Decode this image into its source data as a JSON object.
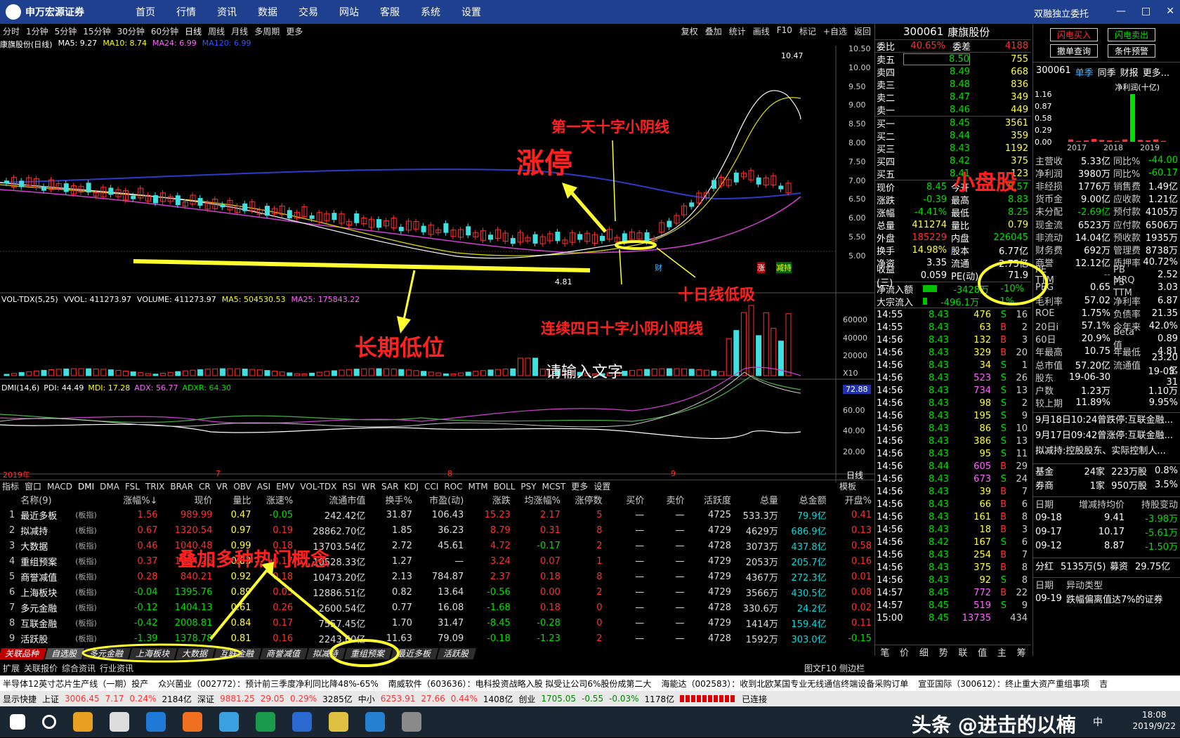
{
  "app": {
    "logo": "申万宏源证券",
    "menus": [
      "首页",
      "行情",
      "资讯",
      "数据",
      "交易",
      "网站",
      "客服",
      "系统",
      "设置"
    ],
    "welcome": "双融独立委托"
  },
  "periods": [
    "分时",
    "1分钟",
    "5分钟",
    "15分钟",
    "30分钟",
    "60分钟",
    "日线",
    "周线",
    "月线",
    "多周期",
    "更多"
  ],
  "tools": [
    "复权",
    "叠加",
    "统计",
    "画线",
    "F10",
    "标记",
    "+自选",
    "返回"
  ],
  "chart_hdr": {
    "name": "康旗股份(日线)",
    "ma5": "MA5: 9.27",
    "ma10": "MA10: 8.74",
    "ma24": "MA24: 6.99",
    "ma120": "MA120: 6.99"
  },
  "price_axis": [
    "10.50",
    "10.00",
    "9.50",
    "9.00",
    "8.50",
    "8.00",
    "7.50",
    "7.00",
    "6.50",
    "6.00",
    "5.50",
    "5.00"
  ],
  "high_label": "10.47",
  "low_label": "4.81",
  "vol_hdr": {
    "name": "VOL-TDX(5,25)",
    "vvol": "VVOL: 411273.97",
    "volume": "VOLUME: 411273.97",
    "ma5": "MA5: 504530.53",
    "ma25": "MA25: 175843.22"
  },
  "vol_axis": [
    "60000",
    "40000",
    "20000",
    "X10"
  ],
  "dmi_hdr": {
    "name": "DMI(14,6)",
    "pdi": "PDI: 44.49",
    "mdi": "MDI: 17.28",
    "adx": "ADX: 56.77",
    "adxr": "ADXR: 64.30"
  },
  "dmi_axis": [
    "72.88",
    "60.00",
    "40.00",
    "20.00"
  ],
  "date_axis": [
    "2019年",
    "7",
    "8",
    "9"
  ],
  "day_line": "日线",
  "indicators": [
    "指标",
    "窗口",
    "MACD",
    "DMI",
    "DMA",
    "FSL",
    "TRIX",
    "BRAR",
    "CR",
    "VR",
    "OBV",
    "ASI",
    "EMV",
    "VOL-TDX",
    "RSI",
    "WR",
    "SAR",
    "KDJ",
    "CCI",
    "ROC",
    "MTM",
    "BOLL",
    "PSY",
    "MCST",
    "更多",
    "设置"
  ],
  "indicator_right": "模板",
  "grid": {
    "headers": [
      "",
      "名称(9)",
      "",
      "涨幅%↓",
      "现价",
      "量比",
      "涨速%",
      "流通市值",
      "换手%",
      "市盈(动)",
      "涨跌",
      "均涨幅%",
      "涨停数",
      "买价",
      "卖价",
      "活跃度",
      "总量",
      "总金额",
      "开盘%"
    ],
    "rows": [
      [
        "1",
        "最近多板",
        "(板指)",
        "1.56",
        "989.99",
        "0.47",
        "-0.05",
        "242.42亿",
        "31.87",
        "106.43",
        "15.23",
        "2.17",
        "5",
        "—",
        "—",
        "4725",
        "533.3万",
        "79.9亿",
        "0.41"
      ],
      [
        "2",
        "拟减持",
        "(板指)",
        "0.67",
        "1320.54",
        "0.97",
        "0.19",
        "28862.70亿",
        "1.85",
        "36.23",
        "8.79",
        "0.31",
        "8",
        "—",
        "—",
        "4729",
        "4629万",
        "686.9亿",
        "0.13"
      ],
      [
        "3",
        "大数据",
        "(板指)",
        "0.46",
        "1040.48",
        "0.99",
        "0.18",
        "13703.54亿",
        "2.72",
        "45.61",
        "4.72",
        "-0.17",
        "2",
        "—",
        "—",
        "4728",
        "3073万",
        "437.8亿",
        "0.58"
      ],
      [
        "4",
        "重组预案",
        "(板指)",
        "0.37",
        "1004.26",
        "0.83",
        "0.17",
        "10528.33亿",
        "1.27",
        "—",
        "3.24",
        "0.07",
        "1",
        "—",
        "—",
        "4729",
        "2053万",
        "205.7亿",
        "0.16"
      ],
      [
        "5",
        "商誉减值",
        "(板指)",
        "0.28",
        "840.21",
        "0.92",
        "0.18",
        "10473.20亿",
        "2.13",
        "784.87",
        "2.37",
        "0.18",
        "8",
        "—",
        "—",
        "4729",
        "4367万",
        "272.3亿",
        "0.01"
      ],
      [
        "6",
        "上海板块",
        "(板指)",
        "-0.04",
        "1395.76",
        "0.89",
        "0.05",
        "12886.51亿",
        "0.82",
        "13.64",
        "-0.56",
        "0.00",
        "2",
        "—",
        "—",
        "4729",
        "3566万",
        "430.5亿",
        "0.08"
      ],
      [
        "7",
        "多元金融",
        "(板指)",
        "-0.12",
        "1404.13",
        "0.61",
        "0.26",
        "2600.54亿",
        "0.77",
        "16.08",
        "-1.68",
        "0.18",
        "0",
        "—",
        "—",
        "4728",
        "330.6万",
        "24.2亿",
        "0.02"
      ],
      [
        "8",
        "互联金融",
        "(板指)",
        "-0.42",
        "2008.81",
        "0.84",
        "0.17",
        "7557.45亿",
        "1.70",
        "31.47",
        "-8.45",
        "-0.28",
        "0",
        "—",
        "—",
        "4729",
        "1414万",
        "159.4亿",
        "0.11"
      ],
      [
        "9",
        "活跃股",
        "(板指)",
        "-1.39",
        "1378.78",
        "0.81",
        "0.16",
        "2243.60亿",
        "11.63",
        "79.09",
        "-0.18",
        "-1.23",
        "2",
        "—",
        "—",
        "4728",
        "1592万",
        "303.0亿",
        "-0.15"
      ]
    ]
  },
  "tabs": [
    "关联品种",
    "自选股",
    "多元金融",
    "上海板块",
    "大数据",
    "互联金融",
    "商誉减值",
    "拟减持",
    "重组预案",
    "最近多板",
    "活跃股"
  ],
  "subtabs": [
    "扩展",
    "关联报价",
    "综合资讯",
    "行业资讯"
  ],
  "subtabs_right": "图文F10 侧边栏",
  "quote": {
    "code": "300061",
    "name": "康旗股份",
    "webi": "40.65%",
    "weicha": "4188",
    "asks": [
      [
        "卖五",
        "8.50",
        "755"
      ],
      [
        "卖四",
        "8.49",
        "668"
      ],
      [
        "卖三",
        "8.48",
        "836"
      ],
      [
        "卖二",
        "8.47",
        "349"
      ],
      [
        "卖一",
        "8.46",
        "449"
      ]
    ],
    "bids": [
      [
        "买一",
        "8.45",
        "3561"
      ],
      [
        "买二",
        "8.44",
        "359"
      ],
      [
        "买三",
        "8.43",
        "1192"
      ],
      [
        "买四",
        "8.42",
        "375"
      ],
      [
        "买五",
        "8.41",
        "123"
      ]
    ],
    "stats": [
      [
        "现价",
        "8.45",
        "今开",
        "8.57"
      ],
      [
        "涨跌",
        "-0.39",
        "最高",
        "8.83"
      ],
      [
        "涨幅",
        "-4.41%",
        "最低",
        "8.25"
      ],
      [
        "总量",
        "411274",
        "量比",
        "0.79"
      ],
      [
        "外盘",
        "185229",
        "内盘",
        "226045"
      ],
      [
        "换手",
        "14.98%",
        "股本",
        "6.77亿"
      ],
      [
        "净资",
        "3.35",
        "流通",
        "2.75亿"
      ],
      [
        "收益(三)",
        "0.059",
        "PE(动)",
        "71.9"
      ]
    ],
    "flow": [
      [
        "净流入额",
        "-3428万",
        "-10%"
      ],
      [
        "大宗流入",
        "-496.1万",
        "-1%"
      ]
    ],
    "ticks": [
      [
        "14:55",
        "8.43",
        "476",
        "S",
        "16"
      ],
      [
        "14:55",
        "8.43",
        "63",
        "B",
        "2"
      ],
      [
        "14:56",
        "8.43",
        "132",
        "B",
        "3"
      ],
      [
        "14:56",
        "8.43",
        "329",
        "B",
        "20"
      ],
      [
        "14:56",
        "8.43",
        "34",
        "S",
        "1"
      ],
      [
        "14:56",
        "8.43",
        "523",
        "S",
        "26"
      ],
      [
        "14:56",
        "8.43",
        "734",
        "S",
        "13"
      ],
      [
        "14:56",
        "8.43",
        "98",
        "S",
        "2"
      ],
      [
        "14:56",
        "8.43",
        "195",
        "S",
        "9"
      ],
      [
        "14:56",
        "8.43",
        "86",
        "S",
        "10"
      ],
      [
        "14:56",
        "8.43",
        "386",
        "S",
        "13"
      ],
      [
        "14:56",
        "8.43",
        "95",
        "S",
        "11"
      ],
      [
        "14:56",
        "8.44",
        "605",
        "B",
        "29"
      ],
      [
        "14:56",
        "8.43",
        "673",
        "S",
        "24"
      ],
      [
        "14:56",
        "8.43",
        "39",
        "B",
        "7"
      ],
      [
        "14:56",
        "8.43",
        "66",
        "B",
        "6"
      ],
      [
        "14:56",
        "8.43",
        "161",
        "B",
        "8"
      ],
      [
        "14:56",
        "8.43",
        "18",
        "B",
        "3"
      ],
      [
        "14:56",
        "8.42",
        "167",
        "S",
        "6"
      ],
      [
        "14:56",
        "8.43",
        "254",
        "B",
        "7"
      ],
      [
        "14:56",
        "8.43",
        "375",
        "B",
        "8"
      ],
      [
        "14:56",
        "8.43",
        "92",
        "S",
        "8"
      ],
      [
        "14:57",
        "8.45",
        "772",
        "B",
        "22"
      ],
      [
        "14:57",
        "8.45",
        "519",
        "S",
        "9"
      ],
      [
        "15:00",
        "8.45",
        "13735",
        "",
        "434"
      ]
    ],
    "bottom_tabs": [
      "笔",
      "价",
      "细",
      "势",
      "联",
      "值",
      "主",
      "筹"
    ]
  },
  "fin": {
    "btns": [
      "闪电买入",
      "闪电卖出",
      "撤单查询",
      "条件预警"
    ],
    "code": "300061",
    "tabs": [
      "单季",
      "同季",
      "财报",
      "更多..."
    ],
    "chart_title": "净利润(十亿)",
    "yvals": [
      "1.16",
      "0.87",
      "0.58",
      "0.29",
      "0.00"
    ],
    "years": [
      "2017",
      "2018",
      "2019"
    ],
    "bars": [
      0.05,
      0.02,
      0.03,
      0.06,
      0.04,
      0.03,
      0.02,
      0.05,
      1.0,
      0.04,
      0.03,
      0.05,
      0.02
    ],
    "rows": [
      [
        "主营收",
        "5.33亿",
        "同比%",
        "-44.00"
      ],
      [
        "净利润",
        "3980万",
        "同比%",
        "-60.17"
      ],
      [
        "非经损",
        "1776万",
        "销售费",
        "1.49亿"
      ],
      [
        "货币金",
        "9.00亿",
        "应收款",
        "1.21亿"
      ],
      [
        "未分配",
        "-2.69亿",
        "预付款",
        "4105万"
      ],
      [
        "现金流",
        "6523万",
        "应付款",
        "6506万"
      ],
      [
        "非流动",
        "14.04亿",
        "预收款",
        "1935万"
      ],
      [
        "财务费",
        "692万",
        "管理费",
        "8738万"
      ],
      [
        "商誉",
        "12.12亿",
        "质押率",
        "40.72%"
      ],
      [
        "PE TTM",
        "--",
        "PB MRQ",
        "2.52"
      ],
      [
        "PEG",
        "0.65",
        "PS TTM",
        "3.03"
      ],
      [
        "毛利率",
        "57.02",
        "净利率",
        "6.87"
      ],
      [
        "ROE",
        "1.75%",
        "负债率",
        "21.35"
      ],
      [
        "20日i",
        "57.1%",
        "今年来",
        "42.0%"
      ],
      [
        "60日",
        "20.9%",
        "Beta值",
        "0.89"
      ],
      [
        "年最高",
        "10.75",
        "年最低",
        "4.81"
      ],
      [
        "总市值",
        "57.20亿",
        "流通值",
        "23.20亿"
      ],
      [
        "股东",
        "19-06-30",
        "",
        "19-03-31"
      ],
      [
        "户数",
        "1.23万",
        "",
        "1.10万"
      ],
      [
        "较上期",
        "11.89%",
        "",
        "9.95%"
      ]
    ],
    "news": [
      "9月18日10:24曾跌停:互联金融...",
      "9月17日09:42曾涨停:互联金融...",
      "拟减持:控股股东、实际控制人..."
    ],
    "inst": [
      [
        "基金",
        "24家",
        "223万股",
        "0.8%"
      ],
      [
        "券商",
        "1家",
        "950万股",
        "3.5%"
      ]
    ],
    "hold_hdr": [
      "日期",
      "增减持均价",
      "持股变动"
    ],
    "hold": [
      [
        "09-18",
        "9.41",
        "-3.98万"
      ],
      [
        "09-17",
        "10.17",
        "-5.61万"
      ],
      [
        "09-12",
        "8.87",
        "-1.50万"
      ]
    ],
    "redline": [
      "分红",
      "5135万(5)",
      "募资",
      "29.75亿"
    ],
    "abn_hdr": [
      "日期",
      "异动类型"
    ],
    "abn": [
      "09-19",
      "跌幅偏离值达7%的证券"
    ]
  },
  "annotations": {
    "zt": "涨停",
    "first": "第一天十字小阴线",
    "xpg": "小盘股",
    "low": "长期低位",
    "shiri": "十日线低吸",
    "four": "连续四日十字小阴小阳线",
    "concept": "叠加多种热门概念",
    "input": "请输入文字"
  },
  "chart_marks": [
    "财",
    "涨",
    "减持"
  ],
  "ticker": [
    "半导体12英寸芯片生产线（一期）投产",
    "众兴菌业（002772）：预计前三季度净利同比降48%-65%",
    "南威软件（603636）：电科投资战略入股 拟受让公司6%股份成第二大",
    "海能达（002583）：收到北欧某国专业无线通信终端设备采购订单",
    "宣亚国际（300612）：终止重大资产重组事项",
    "吉"
  ],
  "status": {
    "label": "显示快捷",
    "sh": "上证",
    "sh_v": "3006.45",
    "sh_c": "7.17",
    "sh_p": "0.24%",
    "sh_a": "2184亿",
    "sz": "深证",
    "sz_v": "9881.25",
    "sz_c": "29.05",
    "sz_p": "0.29%",
    "sz_a": "3285亿",
    "zx": "中小",
    "zx_v": "6253.91",
    "zx_c": "27.66",
    "zx_p": "0.44%",
    "zx_a": "1408亿",
    "cy": "创业",
    "cy_v": "1705.05",
    "cy_c": "-0.55",
    "cy_p": "-0.03%",
    "cy_a": "1178亿",
    "conn": "已连接"
  },
  "taskbar": {
    "time": "18:08",
    "date": "2019/9/22",
    "ime": "中"
  },
  "watermark": "头条 @进击的以楠"
}
